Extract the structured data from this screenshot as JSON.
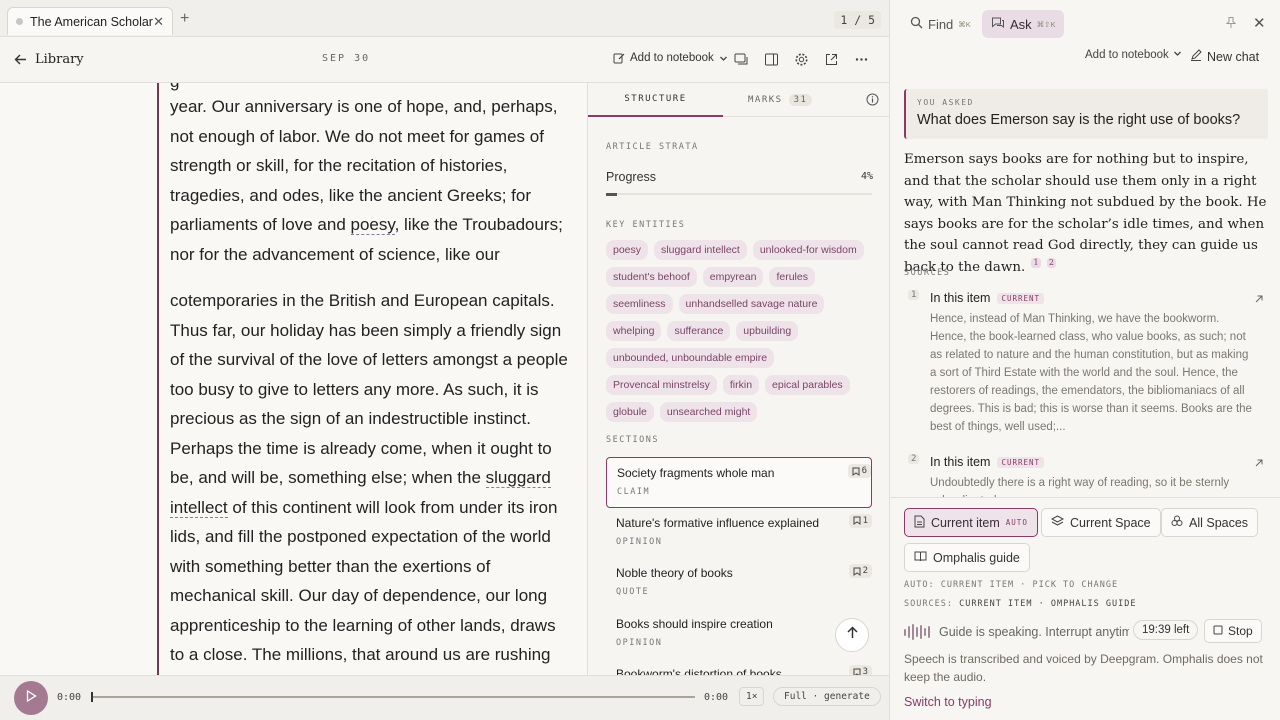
{
  "tabbar": {
    "doc_tab": "The American Scholar",
    "page_count": "1 / 5"
  },
  "toolbar": {
    "back_label": "Library",
    "date": "SEP 30",
    "add_to_notebook": "Add to notebook"
  },
  "reader": {
    "para1": [
      "year. Our anniversary is one of hope, and, perhaps,",
      "not enough of labor. We do not meet for games of",
      "strength or skill, for the recitation of histories,",
      "tragedies, and odes, like the ancient Greeks; for",
      "parliaments of love and ",
      "poesy",
      ", like the Troubadours;",
      "nor for the advancement of science, like our"
    ],
    "para2": [
      "cotemporaries in the British and European capitals.",
      "Thus far, our holiday has been simply a friendly sign",
      "of the survival of the love of letters amongst a people",
      "too busy to give to letters any more. As such, it is",
      "precious as the sign of an indestructible instinct.",
      "Perhaps the time is already come, when it ought to",
      "be, and will be, something else; when the ",
      "sluggard",
      "intellect",
      " of this continent will look from under its iron",
      "lids, and fill the postponed expectation of the world",
      "with something better than the exertions of",
      "mechanical skill. Our day of dependence, our long",
      "apprenticeship to the learning of other lands, draws",
      "to a close. The millions, that around us are rushing"
    ]
  },
  "structure": {
    "tab_structure": "STRUCTURE",
    "tab_marks": "MARKS",
    "marks_count": "31",
    "strata_label": "ARTICLE STRATA",
    "progress_label": "Progress",
    "progress_value": "4%",
    "progress_fraction": 0.04,
    "entities_label": "KEY ENTITIES",
    "entities": [
      "poesy",
      "sluggard intellect",
      "unlooked-for wisdom",
      "student's behoof",
      "empyrean",
      "ferules",
      "seemliness",
      "unhandselled savage nature",
      "whelping",
      "sufferance",
      "upbuilding",
      "unbounded, unboundable empire",
      "Provencal minstrelsy",
      "firkin",
      "epical parables",
      "globule",
      "unsearched might"
    ],
    "sections_label": "SECTIONS",
    "sections": [
      {
        "title": "Society fragments whole man",
        "type": "CLAIM",
        "count": "6"
      },
      {
        "title": "Nature's formative influence explained",
        "type": "OPINION",
        "count": "1"
      },
      {
        "title": "Noble theory of books",
        "type": "QUOTE",
        "count": "2"
      },
      {
        "title": "Books should inspire creation",
        "type": "OPINION",
        "count": ""
      },
      {
        "title": "Bookworm's distortion of books",
        "type": "",
        "count": "3"
      }
    ]
  },
  "player": {
    "time_start": "0:00",
    "time_end": "0:00",
    "speed": "1×",
    "mode": "Full · generate",
    "position_fraction": 0
  },
  "ask": {
    "find_label": "Find",
    "find_kbd": "⌘K",
    "ask_label": "Ask",
    "ask_kbd": "⌘⇧K",
    "add_to_notebook": "Add to notebook",
    "new_chat": "New chat",
    "you_asked_label": "YOU ASKED",
    "question": "What does Emerson say is the right use of books?",
    "answer": "Emerson says books are for nothing but to inspire, and that the scholar should use them only in a right way, with Man Thinking not subdued by the book. He says books are for the scholar’s idle times, and when the soul cannot read God directly, they can guide us back to the dawn.",
    "cites": [
      "1",
      "2"
    ],
    "sources_label": "SOURCES",
    "sources": [
      {
        "num": "1",
        "title": "In this item",
        "badge": "CURRENT",
        "excerpt": "Hence, instead of Man Thinking, we have the bookworm. Hence, the book-learned class, who value books, as such; not as related to nature and the human constitution, but as making a sort of Third Estate with the world and the soul. Hence, the restorers of readings, the emendators, the bibliomaniacs of all degrees. This is bad; this is worse than it seems. Books are the best of things, well used;..."
      },
      {
        "num": "2",
        "title": "In this item",
        "badge": "CURRENT",
        "excerpt": "Undoubtedly there is a right way of reading, so it be sternly subordinated."
      }
    ],
    "scopes": [
      {
        "label": "Current item",
        "tag": "AUTO"
      },
      {
        "label": "Current Space",
        "tag": ""
      },
      {
        "label": "All Spaces",
        "tag": ""
      },
      {
        "label": "Omphalis guide",
        "tag": ""
      }
    ],
    "auto_line": "AUTO: CURRENT ITEM · PICK TO CHANGE",
    "sources_line_prefix": "SOURCES:",
    "sources_line_value": "CURRENT ITEM · OMPHALIS GUIDE",
    "guide_status": "Guide is speaking. Interrupt anytime.",
    "time_left": "19:39 left",
    "stop": "Stop",
    "speech_note": "Speech is transcribed and voiced by Deepgram. Omphalis does not keep the audio.",
    "switch_typing": "Switch to typing"
  },
  "colors": {
    "accent": "#8a3a66",
    "chip_bg": "#efe3ea",
    "reader_rule": "#6e3a5a",
    "play_button": "#a47a93"
  }
}
